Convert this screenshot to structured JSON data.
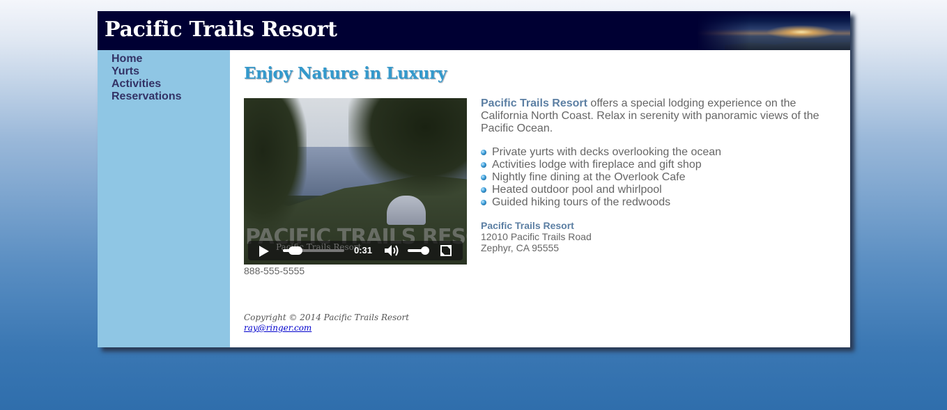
{
  "header": {
    "title": "Pacific Trails Resort"
  },
  "nav": {
    "items": [
      {
        "label": "Home"
      },
      {
        "label": "Yurts"
      },
      {
        "label": "Activities"
      },
      {
        "label": "Reservations"
      }
    ]
  },
  "main": {
    "heading": "Enjoy Nature in Luxury",
    "video": {
      "watermark": "PACIFIC TRAILS RESORT",
      "overlay_title": "Pacific Trails Resort",
      "time": "0:31",
      "progress": 0.2,
      "volume": 0.75
    },
    "phone": "888-555-5555",
    "intro_brand": "Pacific Trails Resort",
    "intro_text": " offers a special lodging experience on the California North Coast. Relax in serenity with panoramic views of the Pacific Ocean.",
    "features": [
      "Private yurts with decks overlooking the ocean",
      "Activities lodge with fireplace and gift shop",
      "Nightly fine dining at the Overlook Cafe",
      "Heated outdoor pool and whirlpool",
      "Guided hiking tours of the redwoods"
    ],
    "address": {
      "name": "Pacific Trails Resort",
      "street": "12010 Pacific Trails Road",
      "city": "Zephyr, CA 95555"
    }
  },
  "footer": {
    "copyright": "Copyright © 2014 Pacific Trails Resort",
    "email": "ray@ringer.com"
  },
  "colors": {
    "header_bg": "#000033",
    "nav_bg": "#8fc6e4",
    "heading": "#3399cc",
    "brand_text": "#5c7fa3",
    "body_text": "#666666",
    "nav_link": "#333366"
  }
}
